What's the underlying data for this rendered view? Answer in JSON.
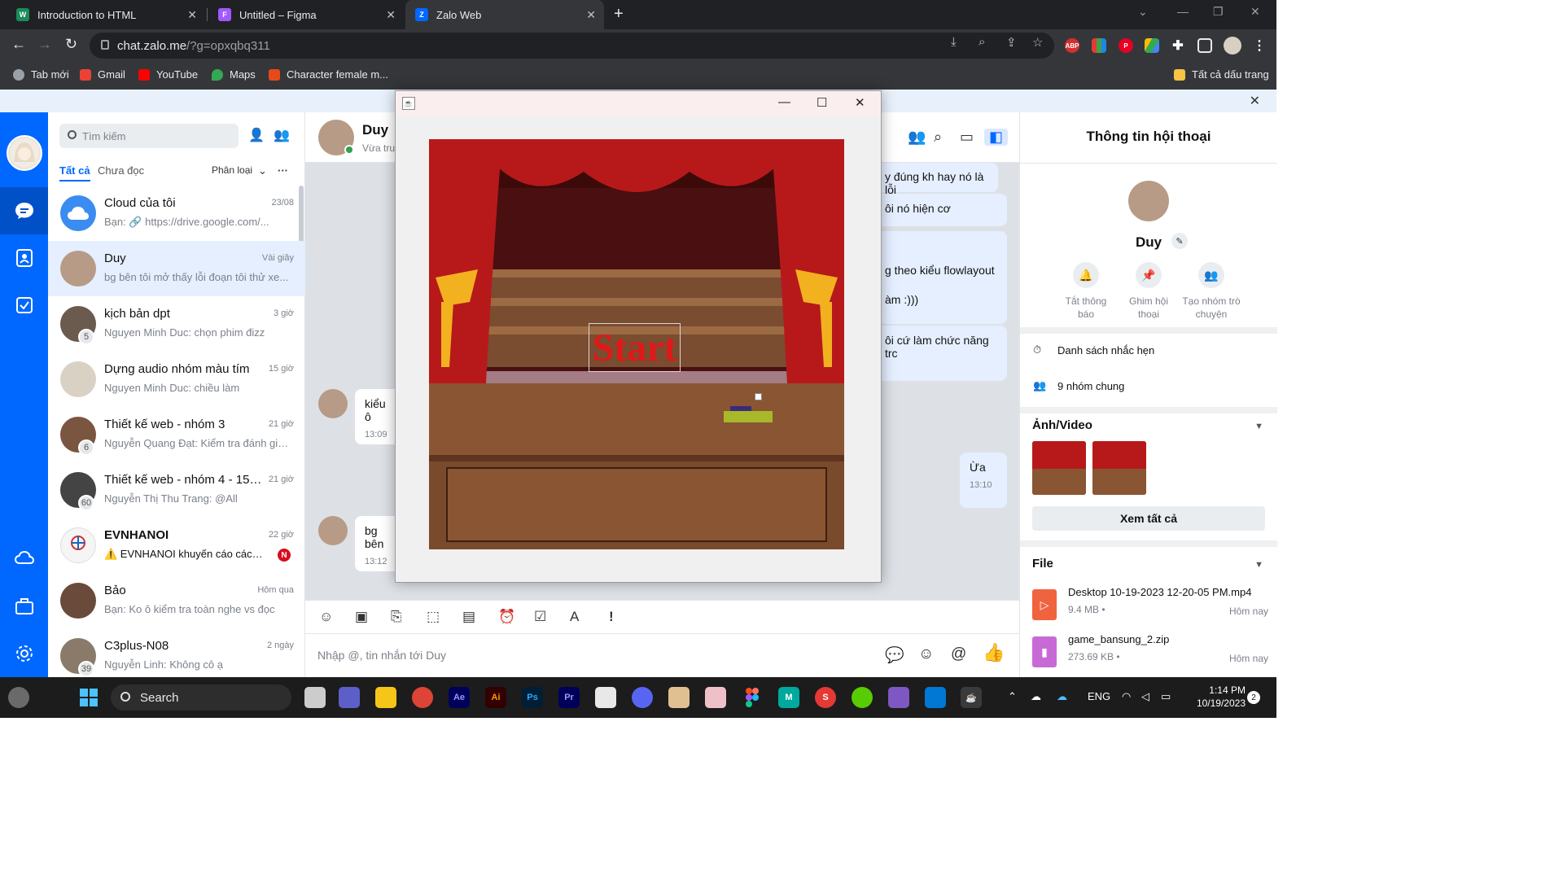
{
  "browser": {
    "tabs": [
      {
        "title": "Introduction to HTML",
        "favicon": "w-icon",
        "active": false
      },
      {
        "title": "Untitled – Figma",
        "favicon": "figma-icon",
        "active": false
      },
      {
        "title": "Zalo Web",
        "favicon": "zalo-icon",
        "active": true
      }
    ],
    "url_host": "chat.zalo.me",
    "url_path": "/?g=opxqbq311",
    "bookmarks": [
      "Tab mới",
      "Gmail",
      "YouTube",
      "Maps",
      "Character female m..."
    ],
    "all_bookmarks": "Tất cả dấu trang",
    "extensions": [
      "ABP"
    ]
  },
  "sidebar": {
    "search_placeholder": "Tìm kiếm",
    "filter_all": "Tất cả",
    "filter_unread": "Chưa đọc",
    "classify": "Phân loại",
    "conversations": [
      {
        "name": "Cloud của tôi",
        "time": "23/08",
        "msg": "Bạn: 🔗 https://drive.google.com/...",
        "color": "#3b8cf0"
      },
      {
        "name": "Duy",
        "time": "Vài giây",
        "msg": "bg bên tôi mở thấy lỗi đoạn tôi thử xe...",
        "color": "#b79b86"
      },
      {
        "name": "kịch bản dpt",
        "time": "3 giờ",
        "msg": "Nguyen Minh Duc: chọn phim đizz",
        "badge": "5",
        "color": "#6b5a4e"
      },
      {
        "name": "Dựng audio nhóm màu tím",
        "time": "15 giờ",
        "msg": "Nguyen Minh Duc: chiều làm",
        "color": "#d9d2c4"
      },
      {
        "name": "Thiết kế web - nhóm 3",
        "time": "21 giờ",
        "msg": "Nguyễn Quang Đạt: Kiểm tra đánh giá...",
        "badge": "6",
        "color": "#7a5540"
      },
      {
        "name": "Thiết kế web - nhóm 4 - 15h ...",
        "time": "21 giờ",
        "msg": "Nguyễn Thị Thu Trang: @All",
        "badge": "60",
        "color": "#444"
      },
      {
        "name": "EVNHANOI",
        "time": "22 giờ",
        "msg": "⚠️ EVNHANOI khuyến cáo cách đ...",
        "nb": "N",
        "color": "#f5f5f5"
      },
      {
        "name": "Bảo",
        "time": "Hôm qua",
        "msg": "Bạn: Ko ô kiểm tra toàn nghe vs đọc",
        "color": "#6a4a3a"
      },
      {
        "name": "C3plus-N08",
        "time": "2 ngày",
        "msg": "Nguyễn Linh: Không cô ạ",
        "badge": "39",
        "color": "#8a7a6a"
      }
    ]
  },
  "chat": {
    "name": "Duy",
    "status": "Vừa truy cập",
    "messages": [
      {
        "text": "y đúng kh hay nó là lỗi",
        "time": "",
        "me": true
      },
      {
        "text": "ôi nó hiện cơ",
        "time": "",
        "me": true
      },
      {
        "text": "g theo kiểu flowlayout",
        "time": "",
        "me": true
      },
      {
        "text": "àm :)))",
        "time": "",
        "me": true
      },
      {
        "text": "ôi cứ làm chức năng trc",
        "time": "",
        "me": true
      },
      {
        "text": "kiểu ô",
        "time": "13:09",
        "me": false
      },
      {
        "text": "Ừa",
        "time": "13:10",
        "me": true
      },
      {
        "text": "bg bên",
        "time": "13:12",
        "me": false
      }
    ],
    "composer_placeholder": "Nhập @, tin nhắn tới Duy"
  },
  "info": {
    "title": "Thông tin hội thoại",
    "name": "Duy",
    "actions": [
      "Tắt thông báo",
      "Ghim hội thoại",
      "Tạo nhóm trò chuyện"
    ],
    "reminders": "Danh sách nhắc hẹn",
    "groups": "9 nhóm chung",
    "media_title": "Ảnh/Video",
    "see_all": "Xem tất cả",
    "file_title": "File",
    "files": [
      {
        "name": "Desktop 10-19-2023 12-20-05 PM.mp4",
        "size": "9.4 MB •",
        "time": "Hôm nay",
        "color": "#f0633f"
      },
      {
        "name": "game_bansung_2.zip",
        "size": "273.69 KB •",
        "time": "Hôm nay",
        "color": "#c76ad6"
      }
    ]
  },
  "java_window": {
    "start_label": "Start"
  },
  "taskbar": {
    "search": "Search",
    "lang": "ENG",
    "time": "1:14 PM",
    "date": "10/19/2023",
    "notifications": "2"
  }
}
